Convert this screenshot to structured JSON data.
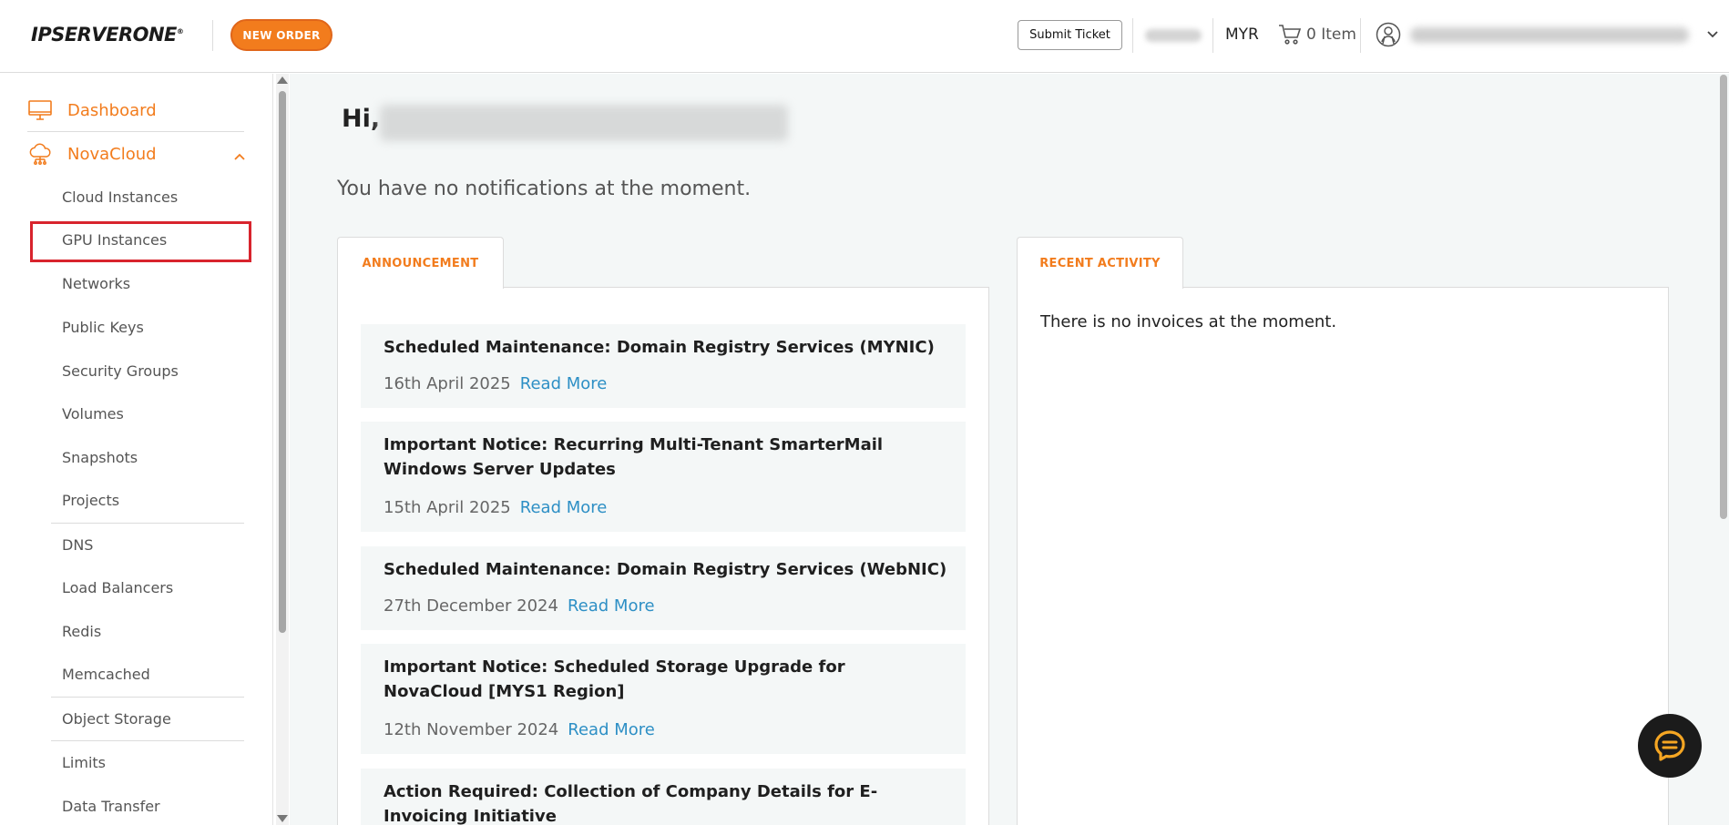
{
  "header": {
    "logo_text": "IPSERVERONE",
    "logo_mark": "®",
    "new_order": "NEW ORDER",
    "submit_ticket": "Submit Ticket",
    "currency": "MYR",
    "cart_label": "0 Item"
  },
  "sidebar": {
    "dashboard": "Dashboard",
    "novacloud": "NovaCloud",
    "items": [
      "Cloud Instances",
      "GPU Instances",
      "Networks",
      "Public Keys",
      "Security Groups",
      "Volumes",
      "Snapshots",
      "Projects",
      "DNS",
      "Load Balancers",
      "Redis",
      "Memcached",
      "Object Storage",
      "Limits",
      "Data Transfer"
    ]
  },
  "main": {
    "greeting": "Hi,",
    "notifications": "You have no notifications at the moment.",
    "announcement_tab": "ANNOUNCEMENT",
    "activity_tab": "RECENT ACTIVITY",
    "activity_empty": "There is no invoices at the moment.",
    "read_more": "Read More",
    "announcements": [
      {
        "title": "Scheduled Maintenance: Domain Registry Services (MYNIC)",
        "date": "16th April 2025"
      },
      {
        "title": "Important Notice: Recurring Multi-Tenant SmarterMail Windows Server Updates",
        "date": "15th April 2025"
      },
      {
        "title": "Scheduled Maintenance: Domain Registry Services (WebNIC)",
        "date": "27th December 2024"
      },
      {
        "title": "Important Notice: Scheduled Storage Upgrade for NovaCloud [MYS1 Region]",
        "date": "12th November 2024"
      },
      {
        "title": "Action Required: Collection of Company Details for E-Invoicing Initiative",
        "date": ""
      }
    ]
  },
  "colors": {
    "accent": "#f27c1d",
    "link": "#2d8fc5",
    "highlight": "#d8242d"
  }
}
